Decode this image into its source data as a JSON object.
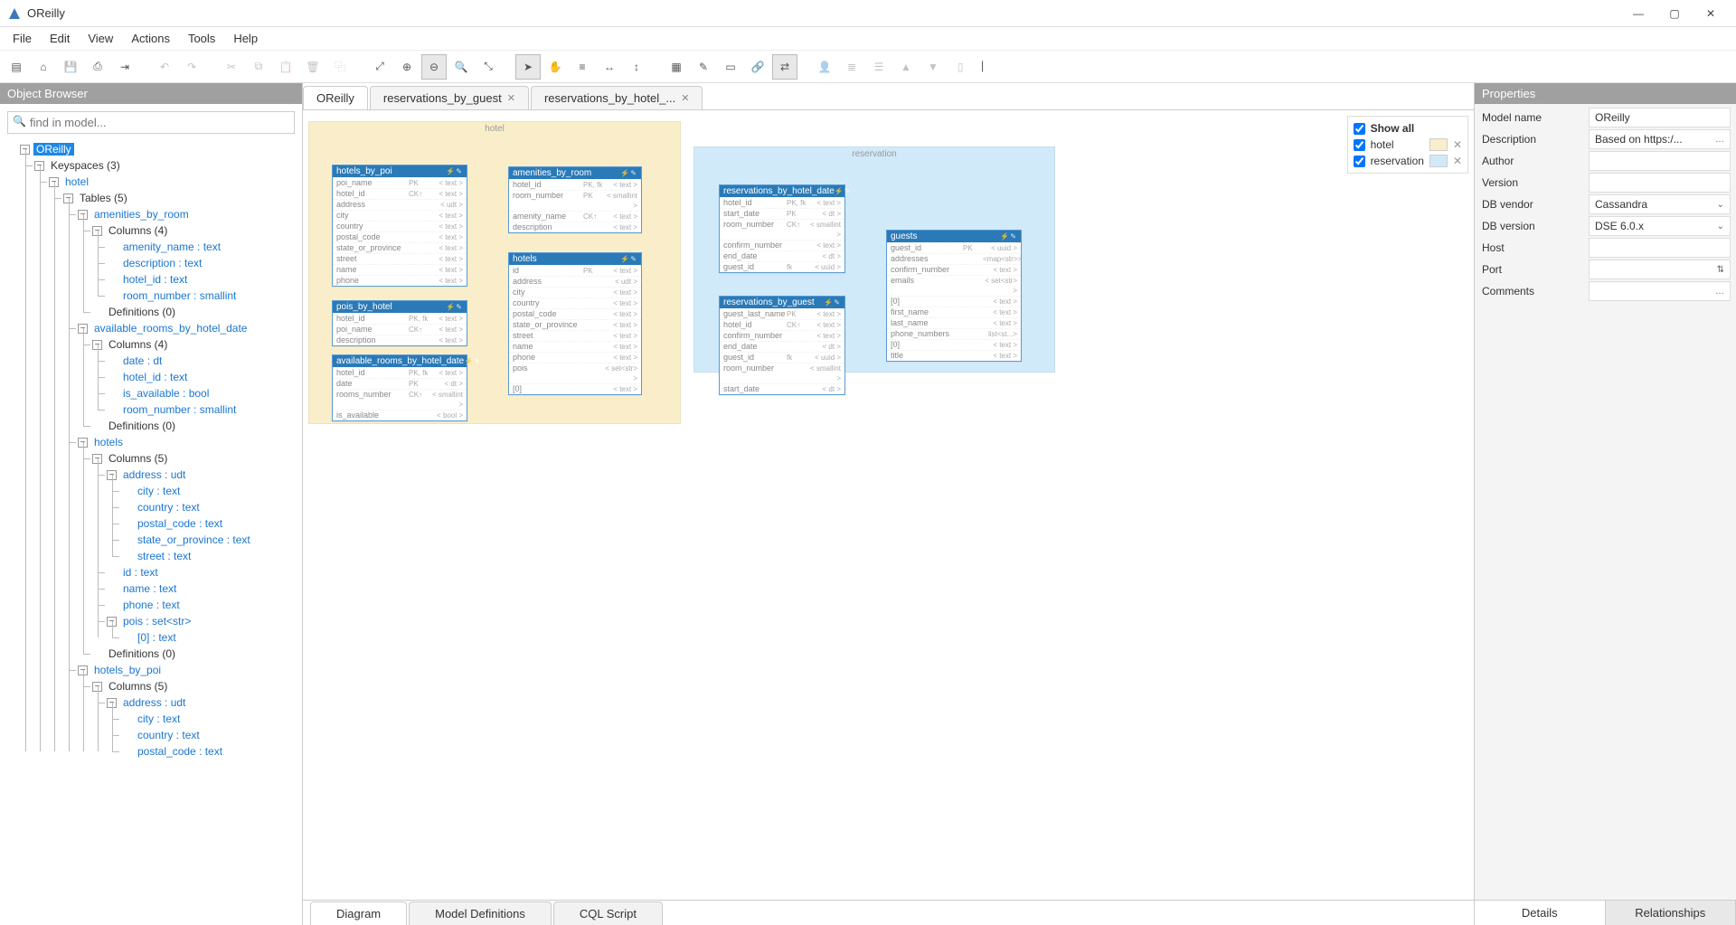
{
  "app": {
    "title": "OReilly"
  },
  "menubar": [
    "File",
    "Edit",
    "View",
    "Actions",
    "Tools",
    "Help"
  ],
  "toolbar_icons": [
    "new-file-icon",
    "open-folder-icon",
    "save-icon",
    "print-icon",
    "export-icon",
    "",
    "undo-icon",
    "redo-icon",
    "",
    "cut-icon",
    "copy-icon",
    "paste-icon",
    "delete-icon",
    "duplicate-icon",
    "",
    "fit-window-icon",
    "zoom-in-icon",
    "zoom-out-icon",
    "zoom-icon",
    "fullscreen-icon",
    "",
    "pointer-icon",
    "hand-icon",
    "align-left-icon",
    "align-horizontal-icon",
    "align-vertical-icon",
    "",
    "grid-icon",
    "add-note-icon",
    "new-entity-icon",
    "link-icon",
    "relation-icon",
    "",
    "user-icon",
    "list-icon",
    "stack-icon",
    "up-icon",
    "down-icon",
    "page-icon",
    "bar-icon"
  ],
  "object_browser": {
    "title": "Object Browser",
    "search_placeholder": "find in model...",
    "root": "OReilly",
    "keyspaces_label": "Keyspaces (3)",
    "items": [
      {
        "l": "hotel",
        "c": [
          {
            "l": "Tables (5)",
            "plain": true,
            "c": [
              {
                "l": "amenities_by_room",
                "c": [
                  {
                    "l": "Columns (4)",
                    "plain": true,
                    "c": [
                      {
                        "l": "amenity_name : text",
                        "leaf": true
                      },
                      {
                        "l": "description : text",
                        "leaf": true
                      },
                      {
                        "l": "hotel_id : text",
                        "leaf": true
                      },
                      {
                        "l": "room_number : smallint",
                        "leaf": true
                      }
                    ]
                  },
                  {
                    "l": "Definitions (0)",
                    "plain": true,
                    "leaf": true
                  }
                ]
              },
              {
                "l": "available_rooms_by_hotel_date",
                "c": [
                  {
                    "l": "Columns (4)",
                    "plain": true,
                    "c": [
                      {
                        "l": "date : dt",
                        "leaf": true
                      },
                      {
                        "l": "hotel_id : text",
                        "leaf": true
                      },
                      {
                        "l": "is_available : bool",
                        "leaf": true
                      },
                      {
                        "l": "room_number : smallint",
                        "leaf": true
                      }
                    ]
                  },
                  {
                    "l": "Definitions (0)",
                    "plain": true,
                    "leaf": true
                  }
                ]
              },
              {
                "l": "hotels",
                "c": [
                  {
                    "l": "Columns (5)",
                    "plain": true,
                    "c": [
                      {
                        "l": "address : udt",
                        "c": [
                          {
                            "l": "city : text",
                            "leaf": true
                          },
                          {
                            "l": "country : text",
                            "leaf": true
                          },
                          {
                            "l": "postal_code : text",
                            "leaf": true
                          },
                          {
                            "l": "state_or_province : text",
                            "leaf": true
                          },
                          {
                            "l": "street : text",
                            "leaf": true
                          }
                        ]
                      },
                      {
                        "l": "id : text",
                        "leaf": true
                      },
                      {
                        "l": "name : text",
                        "leaf": true
                      },
                      {
                        "l": "phone : text",
                        "leaf": true
                      },
                      {
                        "l": "pois : set<str>",
                        "c": [
                          {
                            "l": "[0] : text",
                            "leaf": true
                          }
                        ]
                      }
                    ]
                  },
                  {
                    "l": "Definitions (0)",
                    "plain": true,
                    "leaf": true
                  }
                ]
              },
              {
                "l": "hotels_by_poi",
                "c": [
                  {
                    "l": "Columns (5)",
                    "plain": true,
                    "c": [
                      {
                        "l": "address : udt",
                        "c": [
                          {
                            "l": "city : text",
                            "leaf": true
                          },
                          {
                            "l": "country : text",
                            "leaf": true
                          },
                          {
                            "l": "postal_code : text",
                            "leaf": true
                          }
                        ]
                      }
                    ]
                  }
                ]
              }
            ]
          }
        ]
      }
    ]
  },
  "doc_tabs": [
    {
      "label": "OReilly",
      "closable": false,
      "active": true
    },
    {
      "label": "reservations_by_guest",
      "closable": true
    },
    {
      "label": "reservations_by_hotel_...",
      "closable": true
    }
  ],
  "layers": {
    "show_all": "Show all",
    "items": [
      {
        "name": "hotel",
        "color": "#faeeca"
      },
      {
        "name": "reservation",
        "color": "#d1eaf9"
      }
    ]
  },
  "regions": {
    "hotel": "hotel",
    "reservation": "reservation"
  },
  "entities": {
    "hotels_by_poi": {
      "title": "hotels_by_poi",
      "rows": [
        [
          "poi_name",
          "PK",
          "< text >"
        ],
        [
          "hotel_id",
          "CK↑",
          "< text >"
        ],
        [
          "address",
          "",
          "< udt >"
        ],
        [
          "  city",
          "",
          "< text >"
        ],
        [
          "  country",
          "",
          "< text >"
        ],
        [
          "  postal_code",
          "",
          "< text >"
        ],
        [
          "  state_or_province",
          "",
          "< text >"
        ],
        [
          "  street",
          "",
          "< text >"
        ],
        [
          "name",
          "",
          "< text >"
        ],
        [
          "phone",
          "",
          "< text >"
        ]
      ]
    },
    "pois_by_hotel": {
      "title": "pois_by_hotel",
      "rows": [
        [
          "hotel_id",
          "PK, fk",
          "< text >"
        ],
        [
          "poi_name",
          "CK↑",
          "< text >"
        ],
        [
          "description",
          "",
          "< text >"
        ]
      ]
    },
    "available_rooms_by_hotel_date": {
      "title": "available_rooms_by_hotel_date",
      "rows": [
        [
          "hotel_id",
          "PK, fk",
          "< text >"
        ],
        [
          "date",
          "PK",
          "< dt >"
        ],
        [
          "rooms_number",
          "CK↑",
          "< smallint >"
        ],
        [
          "is_available",
          "",
          "< bool >"
        ]
      ]
    },
    "amenities_by_room": {
      "title": "amenities_by_room",
      "rows": [
        [
          "hotel_id",
          "PK, fk",
          "< text >"
        ],
        [
          "room_number",
          "PK",
          "< smallint >"
        ],
        [
          "amenity_name",
          "CK↑",
          "< text >"
        ],
        [
          "description",
          "",
          "< text >"
        ]
      ]
    },
    "hotels": {
      "title": "hotels",
      "rows": [
        [
          "id",
          "PK",
          "< text >"
        ],
        [
          "address",
          "",
          "< udt >"
        ],
        [
          "  city",
          "",
          "< text >"
        ],
        [
          "  country",
          "",
          "< text >"
        ],
        [
          "  postal_code",
          "",
          "< text >"
        ],
        [
          "  state_or_province",
          "",
          "< text >"
        ],
        [
          "  street",
          "",
          "< text >"
        ],
        [
          "name",
          "",
          "< text >"
        ],
        [
          "phone",
          "",
          "< text >"
        ],
        [
          "pois",
          "",
          "< set<str> >"
        ],
        [
          "  [0]",
          "",
          "< text >"
        ]
      ]
    },
    "reservations_by_hotel_date": {
      "title": "reservations_by_hotel_date",
      "rows": [
        [
          "hotel_id",
          "PK, fk",
          "< text >"
        ],
        [
          "start_date",
          "PK",
          "< dt >"
        ],
        [
          "room_number",
          "CK↑",
          "< smallint >"
        ],
        [
          "confirm_number",
          "",
          "< text >"
        ],
        [
          "end_date",
          "",
          "< dt >"
        ],
        [
          "guest_id",
          "fk",
          "< uuid >"
        ]
      ]
    },
    "reservations_by_guest": {
      "title": "reservations_by_guest",
      "rows": [
        [
          "guest_last_name",
          "PK",
          "< text >"
        ],
        [
          "hotel_id",
          "CK↑",
          "< text >"
        ],
        [
          "confirm_number",
          "",
          "< text >"
        ],
        [
          "end_date",
          "",
          "< dt >"
        ],
        [
          "guest_id",
          "fk",
          "< uuid >"
        ],
        [
          "room_number",
          "",
          "< smallint >"
        ],
        [
          "start_date",
          "",
          "< dt >"
        ]
      ]
    },
    "guests": {
      "title": "guests",
      "rows": [
        [
          "guest_id",
          "PK",
          "< uuid >"
        ],
        [
          "addresses",
          "",
          "<map<str>>"
        ],
        [
          "confirm_number",
          "",
          "< text >"
        ],
        [
          "emails",
          "",
          "< set<str> >"
        ],
        [
          "  [0]",
          "",
          "< text >"
        ],
        [
          "first_name",
          "",
          "< text >"
        ],
        [
          "last_name",
          "",
          "< text >"
        ],
        [
          "phone_numbers",
          "",
          "list<st...>"
        ],
        [
          "  [0]",
          "",
          "< text >"
        ],
        [
          "title",
          "",
          "< text >"
        ]
      ]
    }
  },
  "bottom_tabs": [
    "Diagram",
    "Model Definitions",
    "CQL Script"
  ],
  "properties": {
    "title": "Properties",
    "rows": [
      {
        "label": "Model name",
        "value": "OReilly"
      },
      {
        "label": "Description",
        "value": "Based on https:/...",
        "dots": true
      },
      {
        "label": "Author",
        "value": ""
      },
      {
        "label": "Version",
        "value": ""
      },
      {
        "label": "DB vendor",
        "value": "Cassandra",
        "dropdown": true
      },
      {
        "label": "DB version",
        "value": "DSE 6.0.x",
        "dropdown": true
      },
      {
        "label": "Host",
        "value": ""
      },
      {
        "label": "Port",
        "value": "",
        "spinner": true
      },
      {
        "label": "Comments",
        "value": "",
        "dots": true
      }
    ],
    "tabs": [
      "Details",
      "Relationships"
    ]
  }
}
